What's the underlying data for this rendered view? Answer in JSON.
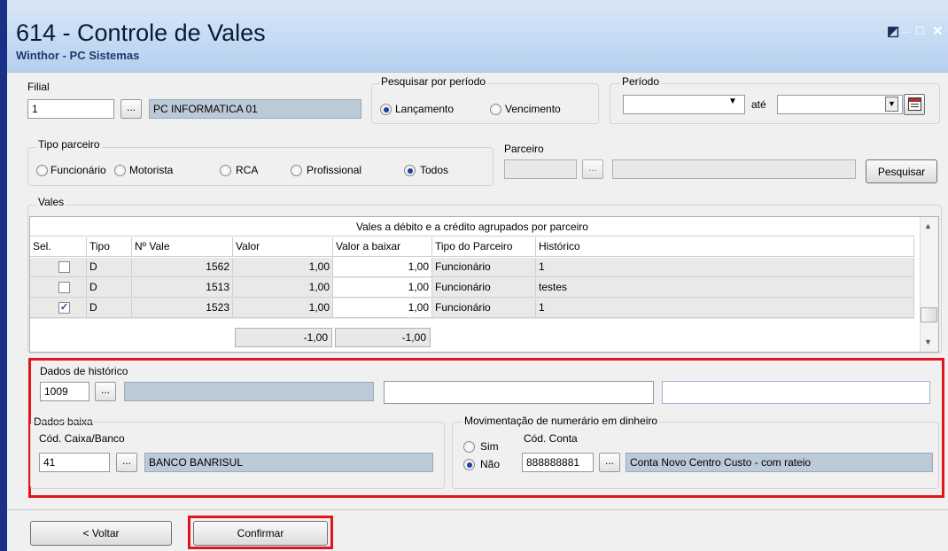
{
  "window": {
    "title": "614 - Controle de Vales",
    "subtitle": "Winthor - PC Sistemas",
    "controls": {
      "help": "◩",
      "minimize": "_",
      "maximize": "□",
      "close": "✕"
    }
  },
  "filial": {
    "label": "Filial",
    "code": "1",
    "lookup_label": "...",
    "name": "PC INFORMATICA 01"
  },
  "pesquisar_periodo": {
    "label": "Pesquisar por período",
    "options": [
      "Lançamento",
      "Vencimento"
    ],
    "selected": "Lançamento"
  },
  "periodo": {
    "label": "Período",
    "from": "",
    "ate_label": "até",
    "to": ""
  },
  "tipo_parceiro": {
    "label": "Tipo parceiro",
    "options": [
      "Funcionário",
      "Motorista",
      "RCA",
      "Profissional",
      "Todos"
    ],
    "selected": "Todos"
  },
  "parceiro": {
    "label": "Parceiro",
    "code": "",
    "lookup_label": "...",
    "name": "",
    "search_button": "Pesquisar"
  },
  "vales": {
    "label": "Vales",
    "group_header": "Vales a débito e a crédito agrupados por parceiro",
    "columns": [
      "Sel.",
      "Tipo",
      "Nº Vale",
      "Valor",
      "Valor a baixar",
      "Tipo do Parceiro",
      "Histórico"
    ],
    "rows": [
      {
        "selected": false,
        "tipo": "D",
        "numero": "1562",
        "valor": "1,00",
        "valor_baixar": "1,00",
        "tipo_parceiro": "Funcionário",
        "historico": "1"
      },
      {
        "selected": false,
        "tipo": "D",
        "numero": "1513",
        "valor": "1,00",
        "valor_baixar": "1,00",
        "tipo_parceiro": "Funcionário",
        "historico": "testes"
      },
      {
        "selected": true,
        "tipo": "D",
        "numero": "1523",
        "valor": "1,00",
        "valor_baixar": "1,00",
        "tipo_parceiro": "Funcionário",
        "historico": "1"
      }
    ],
    "totals": {
      "valor": "-1,00",
      "valor_baixar": "-1,00"
    }
  },
  "dados_historico": {
    "label": "Dados de histórico",
    "code": "1009",
    "lookup_label": "...",
    "name": "",
    "field2": "",
    "field3": ""
  },
  "dados_baixa": {
    "label": "Dados baixa",
    "caixa_label": "Cód. Caixa/Banco",
    "code": "41",
    "lookup_label": "...",
    "name": "BANCO BANRISUL"
  },
  "movimentacao": {
    "label": "Movimentação de numerário em dinheiro",
    "options": [
      "Sim",
      "Não"
    ],
    "selected": "Não",
    "conta_label": "Cód. Conta",
    "conta_code": "888888881",
    "lookup_label": "...",
    "conta_name": "Conta Novo Centro Custo - com rateio"
  },
  "footer": {
    "voltar": "< Voltar",
    "confirmar": "Confirmar"
  },
  "colors": {
    "highlight": "#e0161b",
    "titlebar": "#c7dcf4",
    "disabled_field": "#bcc9d7"
  }
}
